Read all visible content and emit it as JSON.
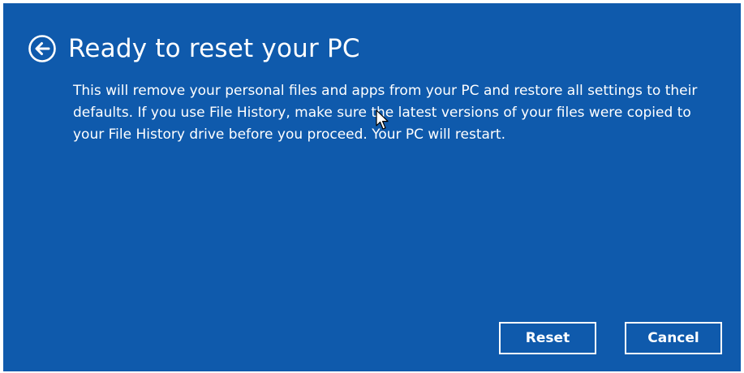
{
  "dialog": {
    "title": "Ready to reset your PC",
    "message": "This will remove your personal files and apps from your PC and restore all settings to their defaults. If you use File History, make sure the latest versions of your files were copied to your File History drive before you proceed. Your PC will restart.",
    "back_icon": "back-arrow-circle-icon"
  },
  "buttons": {
    "reset_label": "Reset",
    "cancel_label": "Cancel"
  },
  "colors": {
    "background": "#0f5aac",
    "text": "#ffffff"
  }
}
